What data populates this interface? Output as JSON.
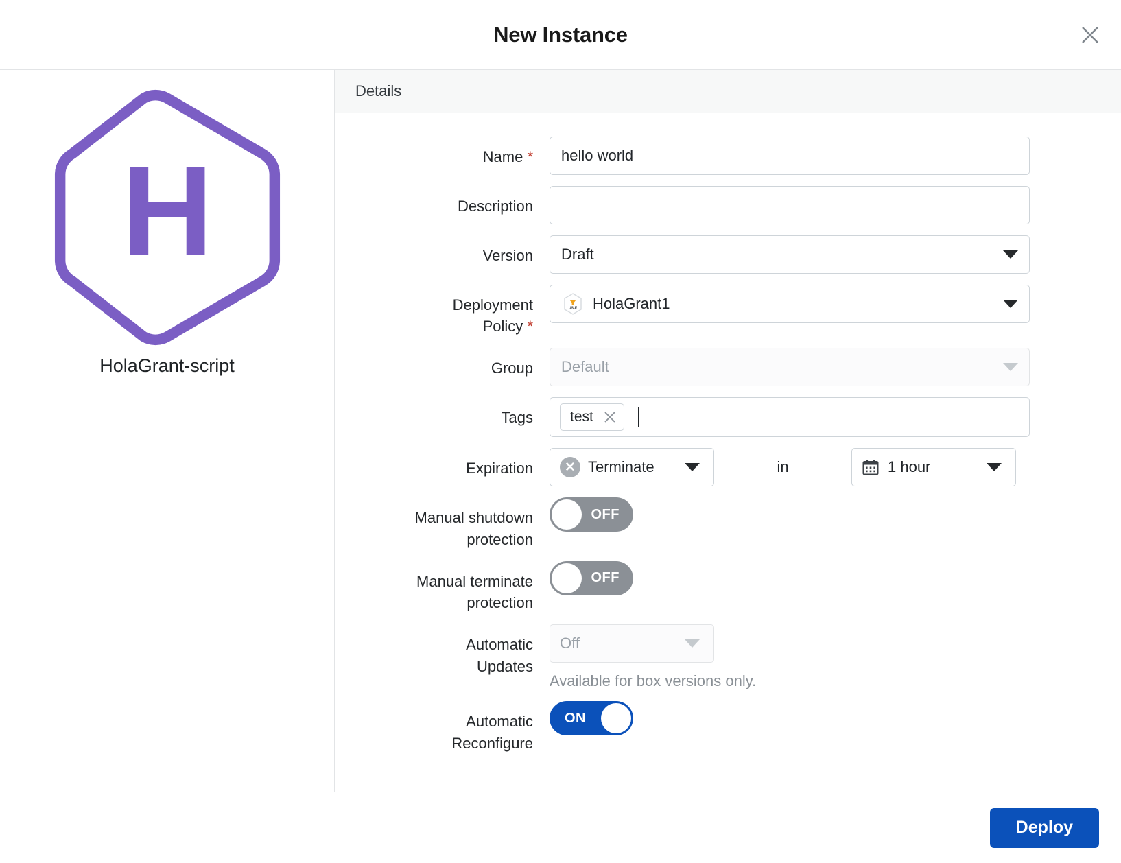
{
  "dialog": {
    "title": "New Instance",
    "close_icon": "close-icon"
  },
  "left_panel": {
    "box_logo_letter": "H",
    "box_name": "HolaGrant-script",
    "logo_color": "#7b5ec4"
  },
  "section": {
    "header_label": "Details"
  },
  "form": {
    "name": {
      "label": "Name",
      "required_marker": "*",
      "value": "hello world",
      "placeholder": ""
    },
    "description": {
      "label": "Description",
      "value": "",
      "placeholder": ""
    },
    "version": {
      "label": "Version",
      "value": "Draft"
    },
    "deployment_policy": {
      "label_line1": "Deployment",
      "label_line2": "Policy",
      "required_marker": "*",
      "value": "HolaGrant1",
      "icon": "deployment-policy-hexagon-icon",
      "icon_text": "US-E"
    },
    "group": {
      "label": "Group",
      "value": "Default",
      "disabled": true
    },
    "tags": {
      "label": "Tags",
      "chips": [
        {
          "label": "test"
        }
      ],
      "input_value": ""
    },
    "expiration": {
      "label": "Expiration",
      "action_value": "Terminate",
      "action_icon": "terminate-circle-x-icon",
      "connector": "in",
      "duration_value": "1 hour",
      "duration_icon": "calendar-icon"
    },
    "manual_shutdown_protection": {
      "label_line1": "Manual shutdown",
      "label_line2": "protection",
      "state": "OFF",
      "on": false
    },
    "manual_terminate_protection": {
      "label_line1": "Manual terminate",
      "label_line2": "protection",
      "state": "OFF",
      "on": false
    },
    "automatic_updates": {
      "label_line1": "Automatic",
      "label_line2": "Updates",
      "value": "Off",
      "disabled": true,
      "hint": "Available for box versions only."
    },
    "automatic_reconfigure": {
      "label_line1": "Automatic",
      "label_line2": "Reconfigure",
      "state": "ON",
      "on": true
    }
  },
  "footer": {
    "deploy_label": "Deploy"
  },
  "colors": {
    "accent_blue": "#0b51ba",
    "brand_purple": "#7b5ec4",
    "required_red": "#c0392b",
    "toggle_off_gray": "#8b9096"
  }
}
